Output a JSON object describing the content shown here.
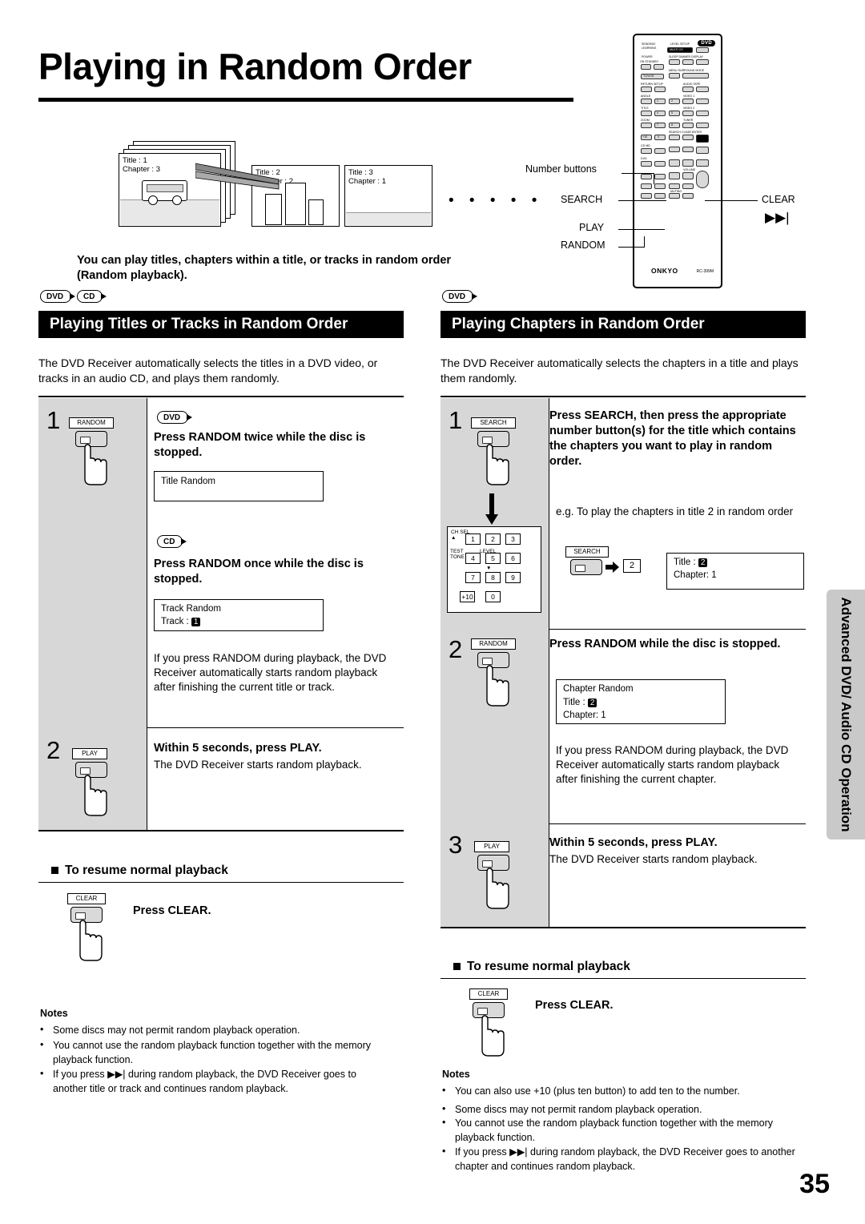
{
  "page": {
    "title": "Playing in Random Order",
    "number": "35",
    "side_tab": "Advanced DVD/ Audio CD Operation"
  },
  "illustration": {
    "frames": [
      {
        "title": "Title : 1",
        "chapter": "Chapter : 3"
      },
      {
        "title": "Title : 2",
        "chapter": "Chapter : 2"
      },
      {
        "title": "Title : 3",
        "chapter": "Chapter : 1"
      }
    ],
    "dots": "• • • • •"
  },
  "intro": "You can play titles, chapters within a title, or tracks in random order (Random playback).",
  "remote": {
    "brand": "ONKYO",
    "model": "RC-399M",
    "logo": "DVD",
    "callouts": [
      {
        "label": "Number buttons"
      },
      {
        "label": "SEARCH"
      },
      {
        "label": "PLAY"
      },
      {
        "label": "RANDOM"
      },
      {
        "label": "CLEAR"
      }
    ],
    "labels": [
      "SENDING/",
      "LEARNING",
      "LEVEL",
      "SETUP",
      "MULTI CH",
      "INPUT",
      "POWER",
      "STANDBY",
      "ON",
      "SLEEP",
      "DIMMER",
      "DISPLAY",
      "TV/VCR",
      "MENU",
      "SURROUND",
      "MODE",
      "RETURN",
      "SETUP",
      "AUDIO",
      "TAPE",
      "ANGLE",
      "ZOOM",
      "SEARCH",
      "CLEAR",
      "ENTER",
      "TITLE",
      "VIDEO 1",
      "VIDEO 2",
      "TUNER",
      "CD",
      "MD",
      "DVD",
      "VOLUME",
      "MUTING"
    ]
  },
  "left_column": {
    "disc_tags": [
      "DVD",
      "CD"
    ],
    "heading": "Playing Titles or Tracks in Random Order",
    "description": "The DVD Receiver automatically selects the titles in a DVD video, or tracks in an audio CD, and plays them randomly.",
    "steps": [
      {
        "num": "1",
        "key": "RANDOM",
        "tag_a": "DVD",
        "title_a": "Press RANDOM twice while the disc is stopped.",
        "osd_a": {
          "line1": "Title Random"
        },
        "tag_b": "CD",
        "title_b": "Press RANDOM once while the disc is stopped.",
        "osd_b": {
          "line1": "Track Random",
          "line2": "Track :",
          "badge": "1"
        },
        "body": "If you press RANDOM during playback, the DVD Receiver automatically starts random playback after finishing the current title or track."
      },
      {
        "num": "2",
        "key": "PLAY",
        "title": "Within 5 seconds, press PLAY.",
        "body": "The DVD Receiver starts random playback."
      }
    ],
    "resume": {
      "heading": "To resume normal playback",
      "key": "CLEAR",
      "label": "Press CLEAR."
    },
    "notes_heading": "Notes",
    "notes": [
      "Some discs may not permit random playback operation.",
      "You cannot use the random playback function together with the memory playback function.",
      "If you press ▶▶| during random playback, the DVD Receiver goes to another title or track and continues random playback."
    ]
  },
  "right_column": {
    "disc_tags": [
      "DVD"
    ],
    "heading": "Playing Chapters in Random Order",
    "description": "The DVD Receiver automatically selects the chapters in a title and plays them randomly.",
    "steps": [
      {
        "num": "1",
        "key": "SEARCH",
        "title": "Press SEARCH, then press the appropriate number button(s) for the title which contains the chapters you want to play in random order.",
        "example": "e.g. To play the chapters in title 2 in random order",
        "keypad": {
          "rows": [
            [
              "1",
              "2",
              "3"
            ],
            [
              "4",
              "5",
              "6"
            ],
            [
              "7",
              "8",
              "9"
            ],
            [
              "+10",
              "0"
            ]
          ],
          "labels": [
            "CH SEL",
            "TEST",
            "TONE",
            "LEVEL"
          ]
        },
        "search_key": "SEARCH",
        "entered": "2",
        "osd": {
          "line1": "Title  :",
          "badge": "2",
          "line2": "Chapter: 1"
        }
      },
      {
        "num": "2",
        "key": "RANDOM",
        "title": "Press RANDOM while the disc is stopped.",
        "osd": {
          "line1": "Chapter Random",
          "line2": "Title   :",
          "badge": "2",
          "line3": "Chapter: 1"
        },
        "body": "If you press RANDOM during playback, the DVD Receiver automatically starts random playback after finishing the current chapter."
      },
      {
        "num": "3",
        "key": "PLAY",
        "title": "Within 5 seconds, press PLAY.",
        "body": "The DVD Receiver starts random playback."
      }
    ],
    "resume": {
      "heading": "To resume normal playback",
      "key": "CLEAR",
      "label": "Press CLEAR."
    },
    "notes_heading": "Notes",
    "notes": [
      "You can also use  +10  (plus ten button) to add ten to the number.",
      "Some discs may not permit random playback operation.",
      "You cannot use the random playback function together with the memory playback function.",
      "If you press ▶▶| during random playback, the DVD Receiver goes to another chapter and continues random playback."
    ]
  }
}
